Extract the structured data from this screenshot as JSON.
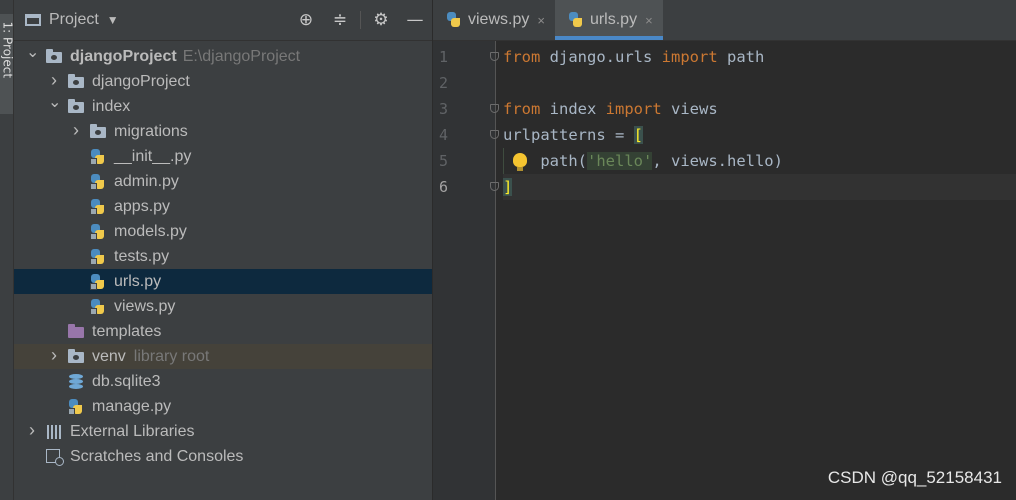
{
  "toolstrip": {
    "label": "1: Project"
  },
  "project_panel": {
    "title": "Project",
    "tree": [
      {
        "label": "djangoProject",
        "meta": "E:\\djangoProject",
        "icon": "folder-icon",
        "depth": 0,
        "expanded": true
      },
      {
        "label": "djangoProject",
        "icon": "folder-icon",
        "depth": 1,
        "expanded": false
      },
      {
        "label": "index",
        "icon": "folder-icon",
        "depth": 1,
        "expanded": true
      },
      {
        "label": "migrations",
        "icon": "folder-icon",
        "depth": 2,
        "expanded": false
      },
      {
        "label": "__init__.py",
        "icon": "python-file-icon",
        "depth": 2
      },
      {
        "label": "admin.py",
        "icon": "python-file-icon",
        "depth": 2
      },
      {
        "label": "apps.py",
        "icon": "python-file-icon",
        "depth": 2
      },
      {
        "label": "models.py",
        "icon": "python-file-icon",
        "depth": 2
      },
      {
        "label": "tests.py",
        "icon": "python-file-icon",
        "depth": 2
      },
      {
        "label": "urls.py",
        "icon": "python-file-icon",
        "depth": 2,
        "selected": true
      },
      {
        "label": "views.py",
        "icon": "python-file-icon",
        "depth": 2
      },
      {
        "label": "templates",
        "icon": "templates-folder-icon",
        "depth": 1
      },
      {
        "label": "venv",
        "meta": "library root",
        "icon": "folder-icon",
        "depth": 1,
        "expanded": false
      },
      {
        "label": "db.sqlite3",
        "icon": "database-icon",
        "depth": 1
      },
      {
        "label": "manage.py",
        "icon": "python-file-icon",
        "depth": 1
      },
      {
        "label": "External Libraries",
        "icon": "libraries-icon",
        "depth": 0,
        "expanded": false
      },
      {
        "label": "Scratches and Consoles",
        "icon": "scratches-icon",
        "depth": 0
      }
    ]
  },
  "editor": {
    "tabs": [
      {
        "label": "views.py",
        "close": "×",
        "active": false
      },
      {
        "label": "urls.py",
        "close": "×",
        "active": true
      }
    ],
    "line_numbers": [
      "1",
      "2",
      "3",
      "4",
      "5",
      "6"
    ],
    "code": {
      "l1_kw1": "from",
      "l1_mod": " django.urls ",
      "l1_kw2": "import",
      "l1_name": " path",
      "l3_kw1": "from",
      "l3_mod": " index ",
      "l3_kw2": "import",
      "l3_name": " views",
      "l4_var": "urlpatterns = ",
      "l4_bracket": "[",
      "l5_fn": "path(",
      "l5_str": "'hello'",
      "l5_rest1": ", views.hello)",
      "l6_bracket": "]"
    }
  },
  "watermark": "CSDN @qq_52158431",
  "colors": {
    "keyword": "#cc7832",
    "string": "#6a8759",
    "text": "#a9b7c6",
    "selection": "#0d293e",
    "tab_underline": "#4a88c7"
  }
}
